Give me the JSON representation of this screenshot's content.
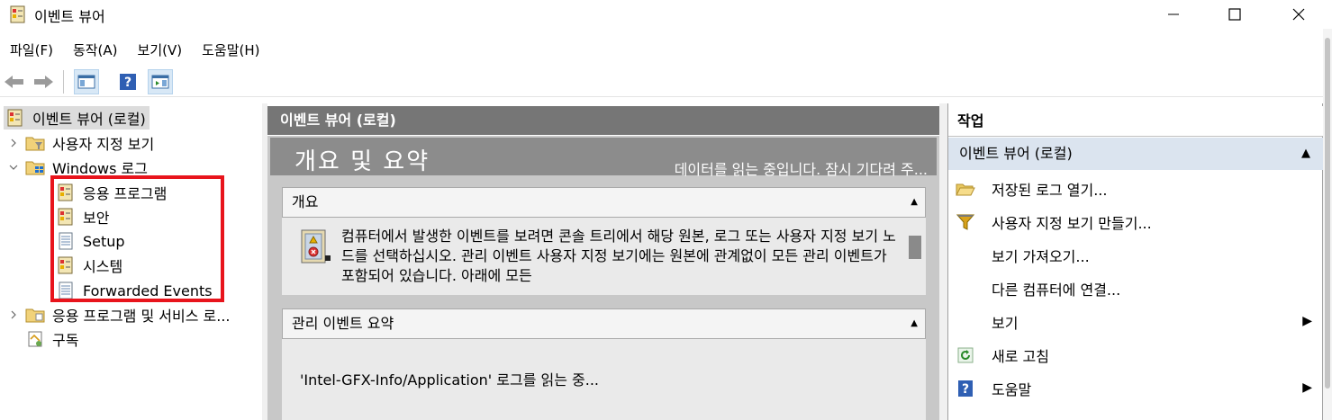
{
  "window": {
    "title": "이벤트 뷰어"
  },
  "menubar": [
    {
      "label": "파일(F)"
    },
    {
      "label": "동작(A)"
    },
    {
      "label": "보기(V)"
    },
    {
      "label": "도움말(H)"
    }
  ],
  "tree": {
    "root": "이벤트 뷰어 (로컬)",
    "custom_views": "사용자 지정 보기",
    "windows_logs": "Windows 로그",
    "logs": [
      "응용 프로그램",
      "보안",
      "Setup",
      "시스템",
      "Forwarded Events"
    ],
    "app_services": "응용 프로그램 및 서비스 로...",
    "subscriptions": "구독"
  },
  "middle": {
    "header": "이벤트 뷰어 (로컬)",
    "overview_title": "개요 및 요약",
    "overview_status": "데이터를 읽는 중입니다. 잠시 기다려 주...",
    "section_overview": {
      "title": "개요",
      "body": "컴퓨터에서 발생한 이벤트를 보려면 콘솔 트리에서 해당 원본, 로그 또는 사용자 지정 보기 노드를 선택하십시오. 관리 이벤트 사용자 지정 보기에는 원본에 관계없이 모든 관리 이벤트가 포함되어 있습니다. 아래에 모든"
    },
    "section_admin": {
      "title": "관리 이벤트 요약",
      "loading": "'Intel-GFX-Info/Application' 로그를 읽는 중..."
    }
  },
  "actions": {
    "header": "작업",
    "group": "이벤트 뷰어 (로컬)",
    "items": [
      {
        "label": "저장된 로그 열기...",
        "icon": "folder-open-icon"
      },
      {
        "label": "사용자 지정 보기 만들기...",
        "icon": "filter-icon"
      },
      {
        "label": "보기 가져오기...",
        "icon": ""
      },
      {
        "label": "다른 컴퓨터에 연결...",
        "icon": ""
      },
      {
        "label": "보기",
        "icon": "",
        "submenu": true
      },
      {
        "label": "새로 고침",
        "icon": "refresh-icon"
      },
      {
        "label": "도움말",
        "icon": "help-icon",
        "submenu": true
      }
    ]
  },
  "colors": {
    "header_gray": "#767676",
    "action_group": "#dbe4ef",
    "highlight_red": "#e8141c"
  }
}
